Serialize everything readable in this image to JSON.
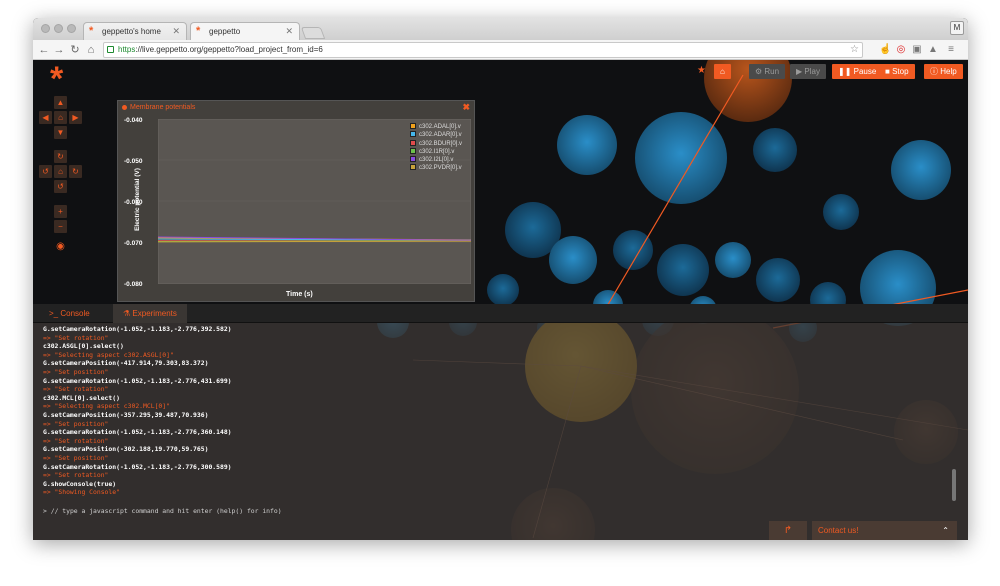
{
  "browser": {
    "tabs": [
      {
        "label": "geppetto's home"
      },
      {
        "label": "geppetto"
      }
    ],
    "url_scheme": "https",
    "url_rest": "://live.geppetto.org/geppetto?load_project_from_id=6",
    "profile_initial": "M"
  },
  "app": {
    "logo_glyph": "*",
    "accent_color": "#f15a22",
    "top_buttons": [
      {
        "icon": "home-icon",
        "label": "⌂",
        "enabled": true
      },
      {
        "icon": "gears-icon",
        "label": "Run",
        "enabled": false
      },
      {
        "icon": "play-icon",
        "label": "Play",
        "enabled": false
      },
      {
        "icon": "pause-icon",
        "label": "Pause",
        "enabled": true
      },
      {
        "icon": "stop-icon",
        "label": "Stop",
        "enabled": true
      },
      {
        "icon": "info-icon",
        "label": "Help",
        "enabled": true
      }
    ]
  },
  "widget": {
    "title": "Membrane potentials",
    "close_glyph": "✖",
    "chart_data": {
      "type": "line",
      "title": "",
      "xlabel": "Time (s)",
      "ylabel": "Electric potential (V)",
      "ylim": [
        -0.08,
        -0.04
      ],
      "xlim": [
        0,
        1
      ],
      "yticks": [
        "-0.040",
        "-0.050",
        "-0.060",
        "-0.070",
        "-0.080"
      ],
      "legend_position": "top-right",
      "series": [
        {
          "name": "c302.ADAL[0].v",
          "color": "#f0a11c",
          "x": [
            0,
            1
          ],
          "y": [
            -0.0688,
            -0.0693
          ]
        },
        {
          "name": "c302.ADAR[0].v",
          "color": "#46b6ea",
          "x": [
            0,
            1
          ],
          "y": [
            -0.0691,
            -0.0694
          ]
        },
        {
          "name": "c302.BDUR[0].v",
          "color": "#e04c4c",
          "x": [
            0,
            1
          ],
          "y": [
            -0.0695,
            -0.0695
          ]
        },
        {
          "name": "c302.I1R[0].v",
          "color": "#6cc24a",
          "x": [
            0,
            1
          ],
          "y": [
            -0.0697,
            -0.0695
          ]
        },
        {
          "name": "c302.I2L[0].v",
          "color": "#8a4ce0",
          "x": [
            0,
            1
          ],
          "y": [
            -0.0686,
            -0.0694
          ]
        },
        {
          "name": "c302.PVDR[0].v",
          "color": "#c8a23a",
          "x": [
            0,
            1
          ],
          "y": [
            -0.0698,
            -0.0696
          ]
        }
      ]
    }
  },
  "console": {
    "tabs": [
      {
        "label": "Console",
        "icon": "terminal-icon"
      },
      {
        "label": "Experiments",
        "icon": "flask-icon"
      }
    ],
    "lines": [
      {
        "kind": "cmd",
        "text": "G.setCameraRotation(-1.052,-1.183,-2.776,392.582)"
      },
      {
        "kind": "res",
        "text": "=> \"Set rotation\""
      },
      {
        "kind": "cmd",
        "text": "c302.ASGL[0].select()"
      },
      {
        "kind": "res",
        "text": "=> \"Selecting aspect c302.ASGL[0]\""
      },
      {
        "kind": "cmd",
        "text": "G.setCameraPosition(-417.914,79.303,83.372)"
      },
      {
        "kind": "res",
        "text": "=> \"Set position\""
      },
      {
        "kind": "cmd",
        "text": "G.setCameraRotation(-1.052,-1.183,-2.776,431.699)"
      },
      {
        "kind": "res",
        "text": "=> \"Set rotation\""
      },
      {
        "kind": "cmd",
        "text": "c302.MCL[0].select()"
      },
      {
        "kind": "res",
        "text": "=> \"Selecting aspect c302.MCL[0]\""
      },
      {
        "kind": "cmd",
        "text": "G.setCameraPosition(-357.295,39.487,70.936)"
      },
      {
        "kind": "res",
        "text": "=> \"Set position\""
      },
      {
        "kind": "cmd",
        "text": "G.setCameraRotation(-1.052,-1.183,-2.776,360.148)"
      },
      {
        "kind": "res",
        "text": "=> \"Set rotation\""
      },
      {
        "kind": "cmd",
        "text": "G.setCameraPosition(-302.188,19.770,59.765)"
      },
      {
        "kind": "res",
        "text": "=> \"Set position\""
      },
      {
        "kind": "cmd",
        "text": "G.setCameraRotation(-1.052,-1.183,-2.776,300.589)"
      },
      {
        "kind": "res",
        "text": "=> \"Set rotation\""
      },
      {
        "kind": "cmd",
        "text": "G.showConsole(true)"
      },
      {
        "kind": "res",
        "text": "=> \"Showing Console\""
      }
    ],
    "prompt_glyph": ">",
    "placeholder": "// type a javascript command and hit enter (help() for info)",
    "contact_label": "Contact us!",
    "share_glyph": "↱",
    "collapse_glyph": "⌃"
  }
}
